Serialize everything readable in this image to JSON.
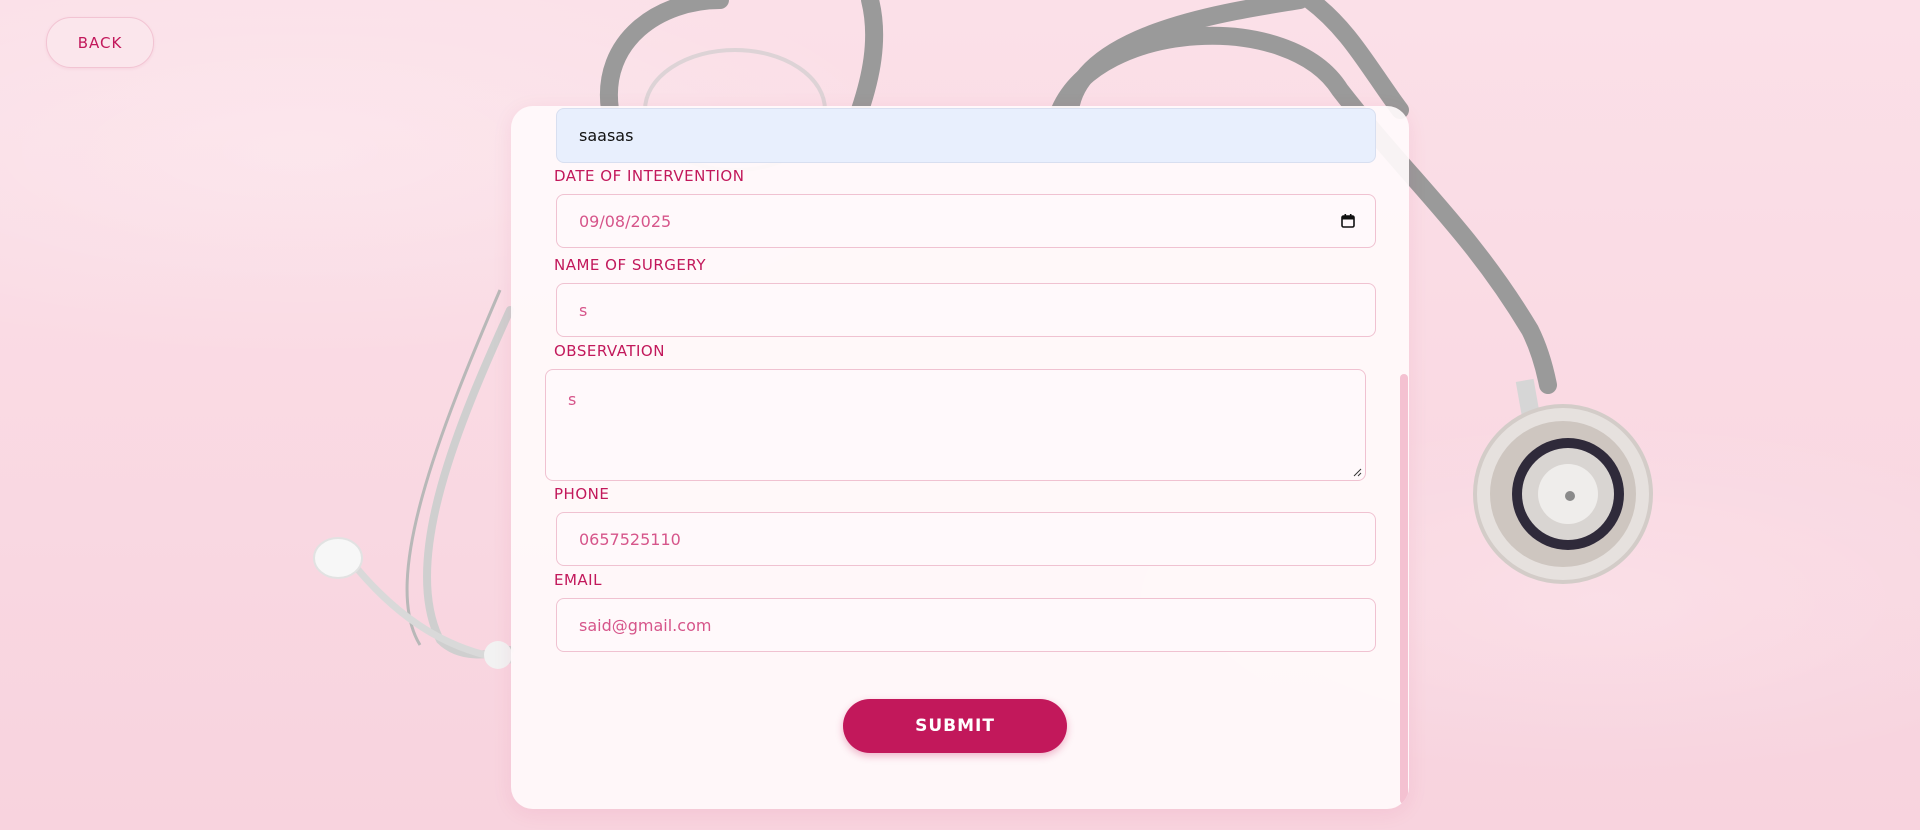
{
  "back_button": {
    "label": "BACK"
  },
  "form": {
    "top_field": {
      "value": "saasas"
    },
    "date_of_intervention": {
      "label": "DATE OF INTERVENTION",
      "value": "09/08/2025",
      "icon": "calendar-icon"
    },
    "name_of_surgery": {
      "label": "NAME OF SURGERY",
      "value": "s"
    },
    "observation": {
      "label": "OBSERVATION",
      "value": "s"
    },
    "phone": {
      "label": "PHONE",
      "value": "0657525110"
    },
    "email": {
      "label": "EMAIL",
      "value": "said@gmail.com"
    },
    "submit": {
      "label": "SUBMIT"
    }
  },
  "colors": {
    "accent": "#c2185b",
    "background": "#f9d9e2",
    "input_text": "#d6558a",
    "prefilled_bg": "#e8effd"
  }
}
